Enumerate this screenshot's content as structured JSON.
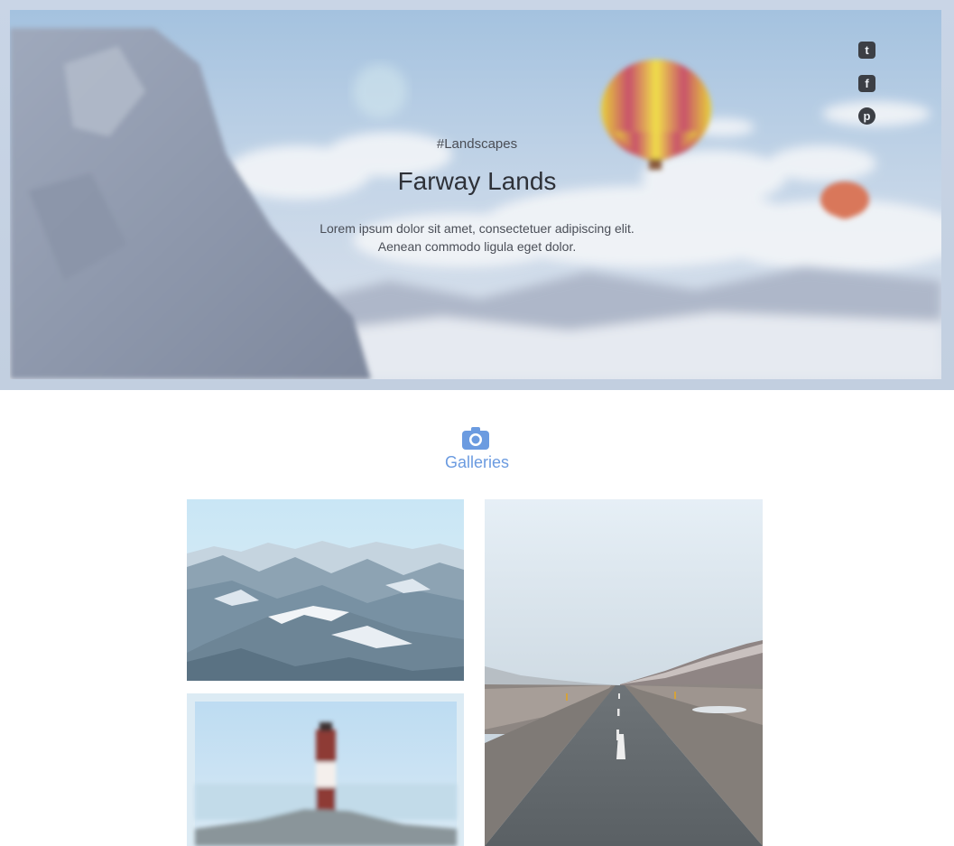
{
  "hero": {
    "tag": "#Landscapes",
    "title": "Farway Lands",
    "description_line1": "Lorem ipsum dolor sit amet, consectetuer adipiscing elit.",
    "description_line2": "Aenean commodo ligula eget dolor."
  },
  "social": {
    "tumblr_glyph": "t",
    "facebook_glyph": "f",
    "pinterest_glyph": "p"
  },
  "galleries": {
    "title": "Galleries",
    "accent_color": "#6b9be0"
  }
}
